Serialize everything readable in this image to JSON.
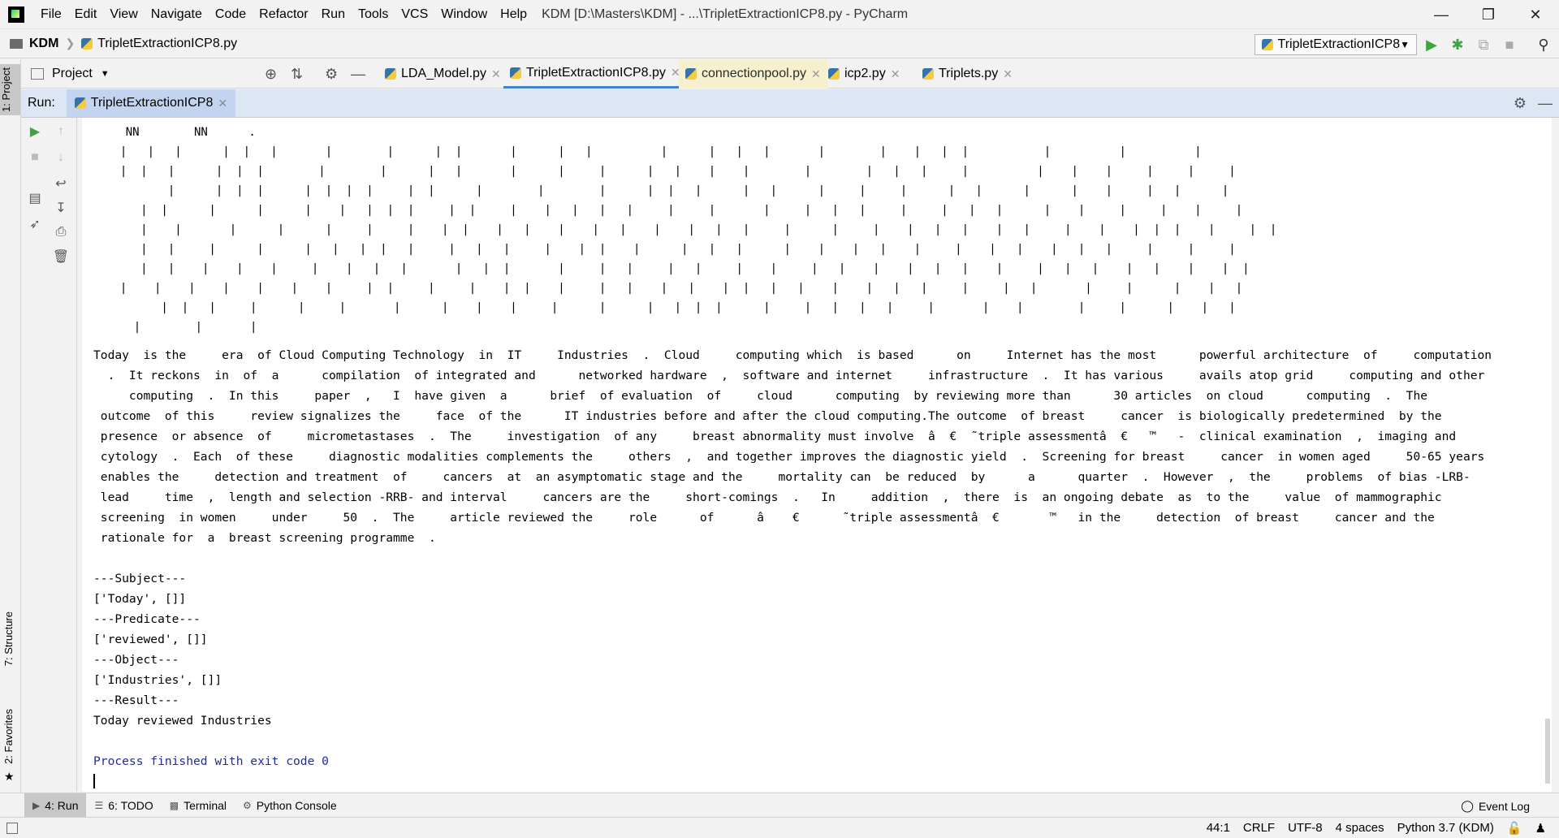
{
  "menubar": {
    "items": [
      "File",
      "Edit",
      "View",
      "Navigate",
      "Code",
      "Refactor",
      "Run",
      "Tools",
      "VCS",
      "Window",
      "Help"
    ],
    "window_title": "KDM [D:\\Masters\\KDM] - ...\\TripletExtractionICP8.py - PyCharm"
  },
  "navbar": {
    "project": "KDM",
    "file": "TripletExtractionICP8.py",
    "run_config": "TripletExtractionICP8"
  },
  "project_panel": {
    "label": "Project"
  },
  "editor_tabs": [
    {
      "label": "LDA_Model.py"
    },
    {
      "label": "TripletExtractionICP8.py"
    },
    {
      "label": "connectionpool.py"
    },
    {
      "label": "icp2.py"
    },
    {
      "label": "Triplets.py"
    }
  ],
  "left_stripe": {
    "project_tab": "1: Project",
    "structure_tab": "7: Structure",
    "favorites_tab": "2: Favorites"
  },
  "run_panel": {
    "label": "Run:",
    "tab": "TripletExtractionICP8"
  },
  "console": {
    "tree_top": "    NN        NN      .",
    "tree_lines": [
      "  |   |   |      |  |   |       |        |      |  |       |      |   |          |      |   |   |       |        |    |   |  |           |          |          |",
      "  |  |   |      |  |  |        |        |      |   |       |      |     |      |   |    |    |        |        |   |   |     |          |    |    |     |     |     |",
      "         |      |  |  |      |  |  |  |     |  |      |        |        |      |  |   |      |   |      |     |     |      |   |      |      |    |     |   |      |",
      "     |  |      |      |      |    |   |  |  |     |  |     |    |   |   |   |     |     |       |     |   |   |     |     |   |   |      |    |     |     |    |     |",
      "     |    |       |      |      |     |     |    |  |    |   |    |    |   |    |    |   |   |     |      |     |    |   |   |    |   |     |    |    |  |  |    |     |  |",
      "     |   |     |      |      |   |   |  |   |     |   |   |     |    |  |    |      |   |   |      |    |    |   |    |     |    |   |    |   |   |     |     |     |",
      "     |   |    |    |    |     |    |   |   |       |   |  |       |     |   |     |   |     |    |     |   |    |    |   |   |    |     |   |   |    |   |    |    |  |",
      "  |    |    |    |    |    |    |     |  |     |     |    |  |    |     |   |    |   |    |  |   |   |    |    |   |   |     |     |   |       |     |      |    |   |",
      "        |  |   |     |      |     |       |      |    |    |     |      |      |   |  |  |      |     |   |   |   |     |       |    |        |     |      |    |   |",
      "    |        |       |"
    ],
    "output_lines": [
      "Today  is the     era  of Cloud Computing Technology  in  IT     Industries  .  Cloud     computing which  is based      on     Internet has the most      powerful architecture  of     computation",
      "  .  It reckons  in  of  a      compilation  of integrated and      networked hardware  ,  software and internet     infrastructure  .  It has various     avails atop grid     computing and other",
      "     computing  .  In this     paper  ,   I  have given  a      brief  of evaluation  of     cloud      computing  by reviewing more than      30 articles  on cloud      computing  .  The",
      " outcome  of this     review signalizes the     face  of the      IT industries before and after the cloud computing.The outcome  of breast     cancer  is biologically predetermined  by the",
      " presence  or absence  of     micrometastases  .  The     investigation  of any     breast abnormality must involve  â  €  ˜triple assessmentâ  €   ™   -  clinical examination  ,  imaging and",
      " cytology  .  Each  of these     diagnostic modalities complements the     others  ,  and together improves the diagnostic yield  .  Screening for breast     cancer  in women aged     50-65 years",
      " enables the     detection and treatment  of     cancers  at  an asymptomatic stage and the     mortality can  be reduced  by      a      quarter  .  However  ,  the     problems  of bias -LRB-",
      " lead     time  ,  length and selection -RRB- and interval     cancers are the     short-comings  .   In     addition  ,  there  is  an ongoing debate  as  to the     value  of mammographic",
      " screening  in women     under     50  .  The     article reviewed the     role      of      â    €      ˜triple assessmentâ  €       ™   in the     detection  of breast     cancer and the",
      " rationale for  a  breast screening programme  .",
      "",
      "---Subject---",
      "['Today', []]",
      "---Predicate---",
      "['reviewed', []]",
      "---Object---",
      "['Industries', []]",
      "---Result---",
      "Today reviewed Industries",
      ""
    ],
    "process_finished": "Process finished with exit code 0"
  },
  "bottom_tabs": [
    {
      "label": "4: Run"
    },
    {
      "label": "6: TODO"
    },
    {
      "label": "Terminal"
    },
    {
      "label": "Python Console"
    }
  ],
  "event_log": "Event Log",
  "status_bar": {
    "position": "44:1",
    "line_sep": "CRLF",
    "encoding": "UTF-8",
    "indent": "4 spaces",
    "interpreter": "Python 3.7 (KDM)"
  },
  "colors": {
    "accent": "#4083c9",
    "run_green": "#3fa33f",
    "console_blue": "#1f2ba1"
  }
}
